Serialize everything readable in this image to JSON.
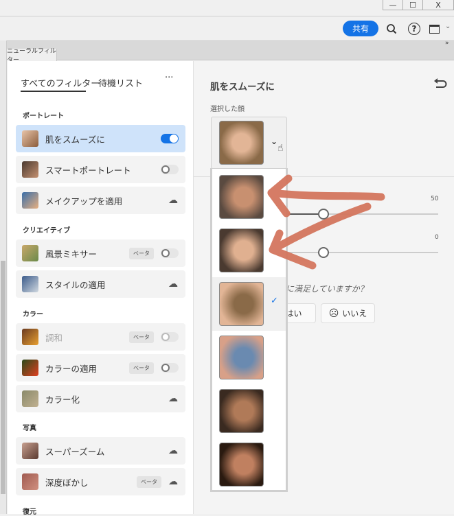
{
  "window": {
    "minimize": "—",
    "maximize": "☐",
    "close": "X"
  },
  "toolbar": {
    "share": "共有",
    "search_icon": "search",
    "help_icon": "help",
    "panel_icon": "panel",
    "chevron": "⌄"
  },
  "panel": {
    "collapse": "»",
    "tab": "ニューラルフィルター"
  },
  "filters": {
    "tabs": [
      "すべてのフィルター",
      "待機リスト"
    ],
    "more": "···",
    "sections": [
      {
        "title": "ポートレート",
        "items": [
          {
            "label": "肌をスムーズに",
            "state": "on",
            "selected": true
          },
          {
            "label": "スマートポートレート",
            "state": "off"
          },
          {
            "label": "メイクアップを適用",
            "state": "cloud"
          }
        ]
      },
      {
        "title": "クリエイティブ",
        "items": [
          {
            "label": "風景ミキサー",
            "beta": "ベータ",
            "state": "off"
          },
          {
            "label": "スタイルの適用",
            "state": "cloud"
          }
        ]
      },
      {
        "title": "カラー",
        "items": [
          {
            "label": "調和",
            "beta": "ベータ",
            "state": "disabled"
          },
          {
            "label": "カラーの適用",
            "beta": "ベータ",
            "state": "off"
          },
          {
            "label": "カラー化",
            "state": "cloud"
          }
        ]
      },
      {
        "title": "写真",
        "items": [
          {
            "label": "スーパーズーム",
            "state": "cloud"
          },
          {
            "label": "深度ぼかし",
            "beta": "ベータ",
            "state": "cloud"
          }
        ]
      },
      {
        "title": "復元",
        "items": []
      }
    ]
  },
  "detail": {
    "title": "肌をスムーズに",
    "selected_face_label": "選択した顔",
    "slider1_value": "50",
    "slider2_value": "0",
    "question": "に満足していますか？",
    "yes": "はい",
    "no": "いいえ",
    "check": "✓",
    "selected_face_index": 2
  },
  "colors": {
    "accent": "#1473e6",
    "annotation": "#d4765e"
  }
}
